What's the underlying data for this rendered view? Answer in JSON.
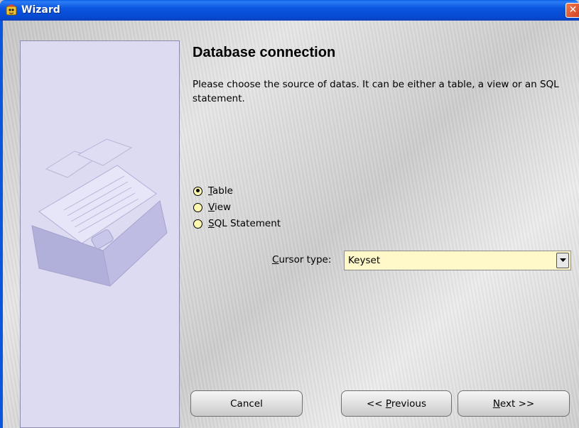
{
  "window": {
    "title": "Wizard",
    "app_icon": "wizard-app-icon",
    "close_icon": "close-icon"
  },
  "page": {
    "heading": "Database connection",
    "description": "Please choose the source of datas. It can be either a table, a view or an SQL statement."
  },
  "source_options": [
    {
      "mnemonic": "T",
      "rest": "able",
      "checked": true
    },
    {
      "mnemonic": "V",
      "rest": "iew",
      "checked": false
    },
    {
      "mnemonic": "S",
      "rest": "QL Statement",
      "checked": false
    }
  ],
  "cursor_type": {
    "label_mnemonic": "C",
    "label_rest": "ursor type:",
    "value": "Keyset"
  },
  "buttons": {
    "cancel": "Cancel",
    "previous_prefix": "<< ",
    "previous_mnemonic": "P",
    "previous_rest": "revious",
    "next_mnemonic": "N",
    "next_rest": "ext >>"
  },
  "colors": {
    "title_bar": "#0b55df",
    "side_panel": "#dcdbf2",
    "field_background": "#fff8c8"
  }
}
